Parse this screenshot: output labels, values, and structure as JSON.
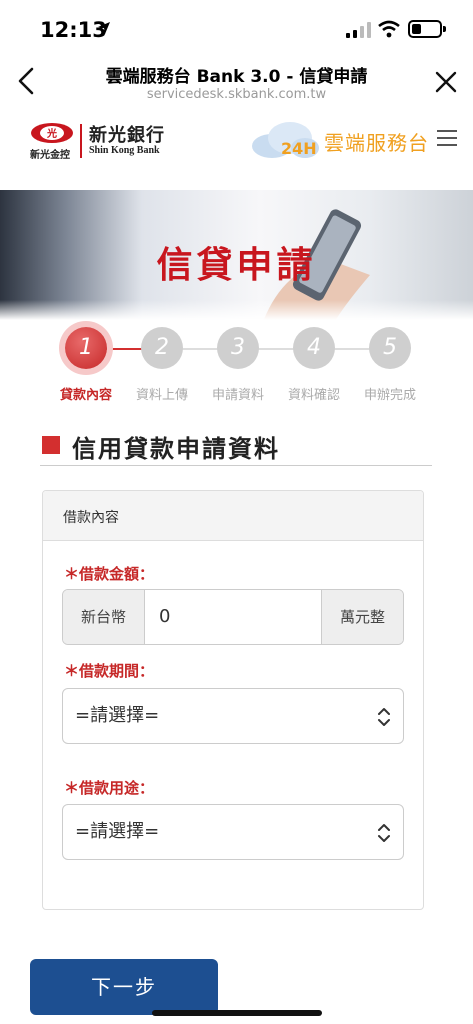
{
  "status": {
    "time": "12:13"
  },
  "browser": {
    "title": "雲端服務台 Bank 3.0 - 信貸申請",
    "url": "servicedesk.skbank.com.tw"
  },
  "site": {
    "logo_sub": "新光金控",
    "logo_name": "新光銀行",
    "logo_name_en": "Shin Kong Bank",
    "tag_24h": "24H",
    "brand": "雲端服務台"
  },
  "banner": {
    "title": "信貸申請"
  },
  "steps": [
    {
      "num": "1",
      "label": "貸款內容",
      "active": true
    },
    {
      "num": "2",
      "label": "資料上傳",
      "active": false
    },
    {
      "num": "3",
      "label": "申請資料",
      "active": false
    },
    {
      "num": "4",
      "label": "資料確認",
      "active": false
    },
    {
      "num": "5",
      "label": "申辦完成",
      "active": false
    }
  ],
  "section": {
    "title": "信用貸款申請資料"
  },
  "form": {
    "panel_title": "借款內容",
    "amount": {
      "label": "＊借款金額：",
      "prefix": "新台幣",
      "value": "0",
      "suffix": "萬元整"
    },
    "period": {
      "label": "＊借款期間：",
      "selected": "=請選擇="
    },
    "purpose": {
      "label": "＊借款用途：",
      "selected": "=請選擇="
    }
  },
  "next_button": "下一步",
  "colors": {
    "brand_red": "#c62828",
    "brand_orange": "#f0a020",
    "button_blue": "#1d4f91"
  }
}
